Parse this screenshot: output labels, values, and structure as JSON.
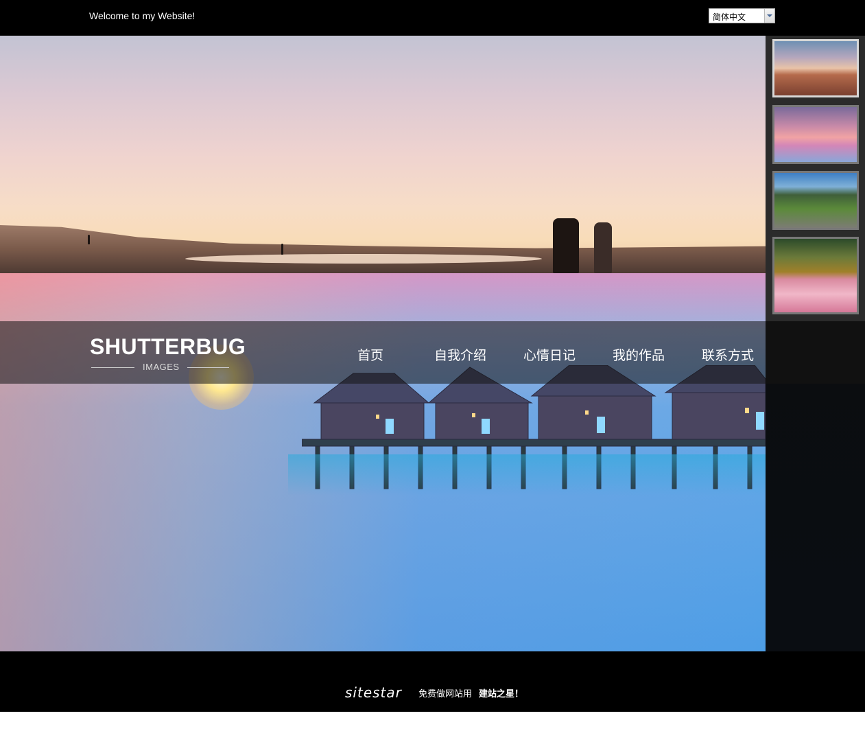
{
  "header": {
    "welcome_text": "Welcome to my Website!",
    "language_select": {
      "value": "简体中文"
    }
  },
  "logo": {
    "title": "SHUTTERBUG",
    "subtitle": "IMAGES"
  },
  "nav": {
    "items": [
      {
        "label": "首页"
      },
      {
        "label": "自我介绍"
      },
      {
        "label": "心情日记"
      },
      {
        "label": "我的作品"
      },
      {
        "label": "联系方式"
      }
    ]
  },
  "slideshow": {
    "active_index": 1,
    "thumbnail_count": 4
  },
  "footer": {
    "brand": "sitestar",
    "slogan": "免费做网站用",
    "slogan_strong": "建站之星！"
  },
  "colors": {
    "topbar_bg": "#000000",
    "footer_bg": "#000000",
    "rail_bg": "#2b2b2b",
    "text": "#ffffff"
  }
}
